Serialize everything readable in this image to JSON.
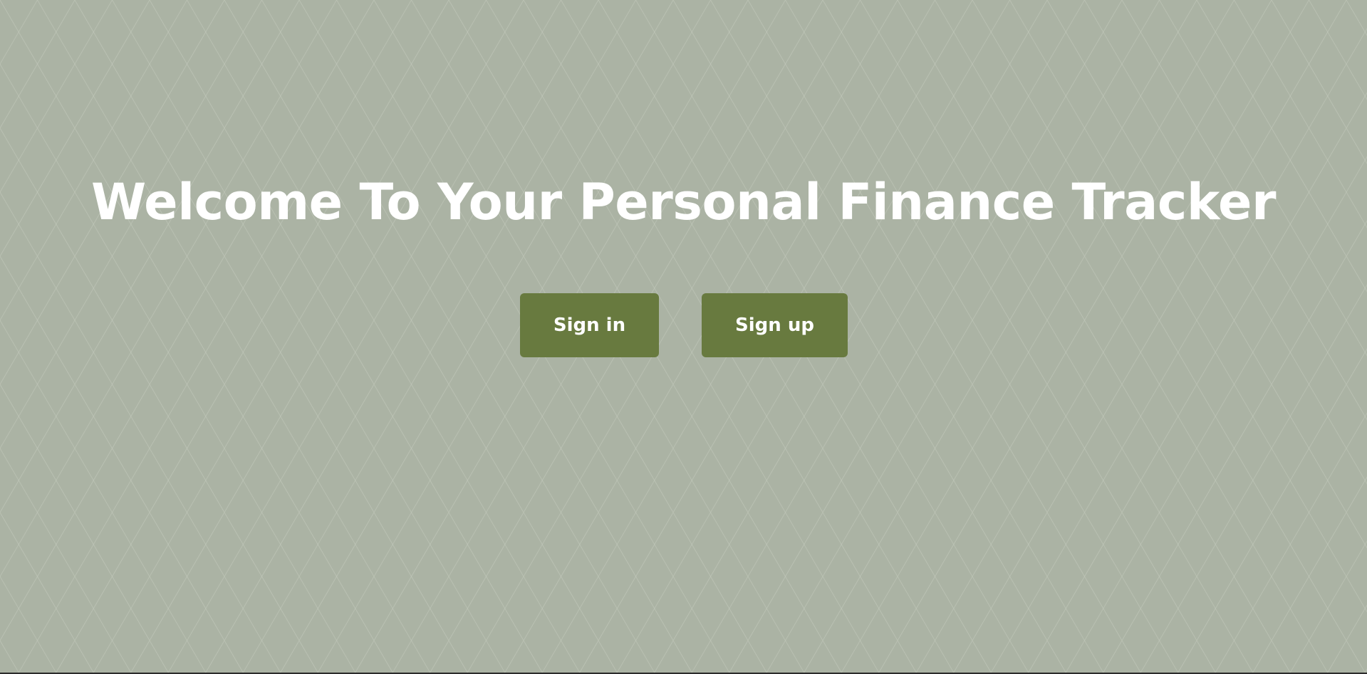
{
  "page": {
    "heading": "Welcome To Your Personal Finance Tracker"
  },
  "actions": {
    "signin_label": "Sign in",
    "signup_label": "Sign up"
  },
  "colors": {
    "background_dark": "#9aa193",
    "background_light": "#abb3a4",
    "pattern_line": "#c4cabd",
    "button_bg": "#687a3f",
    "text": "#ffffff"
  },
  "background": {
    "pattern": "argyle-diamonds"
  }
}
